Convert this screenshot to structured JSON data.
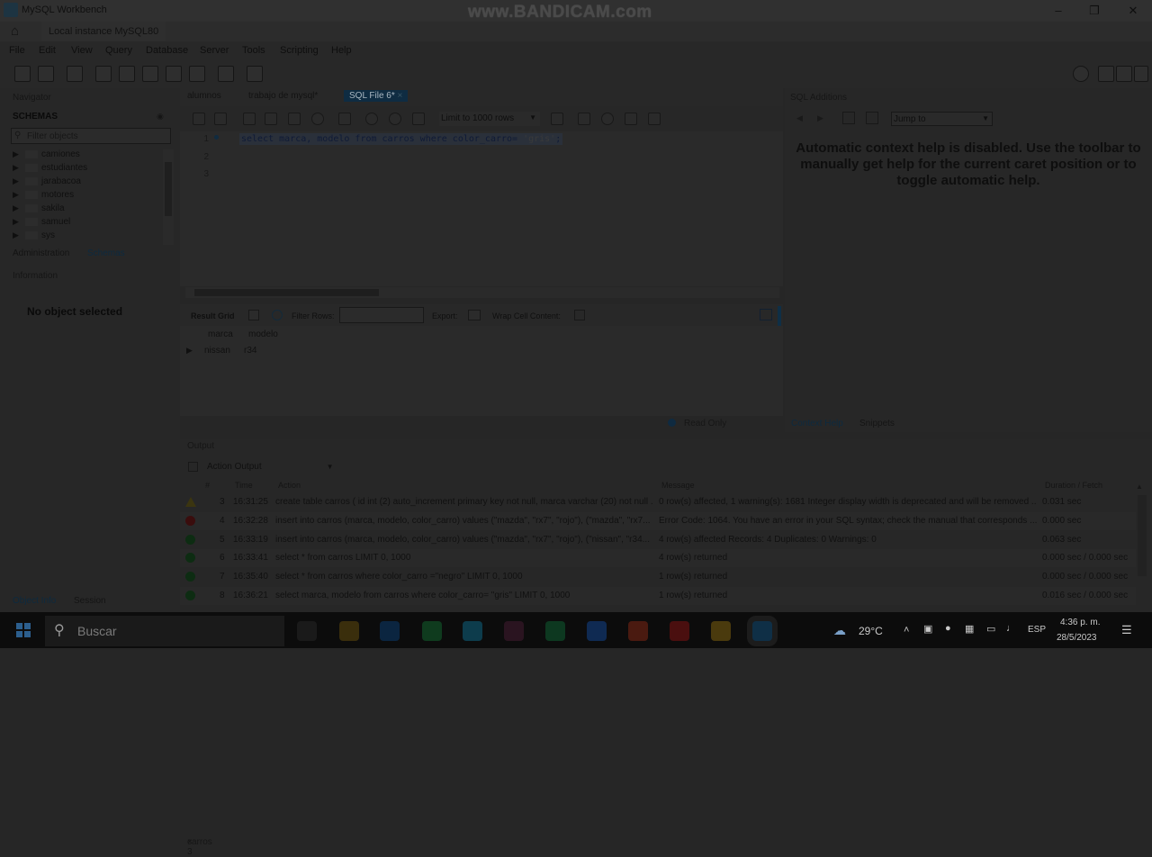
{
  "window": {
    "title": "MySQL Workbench",
    "watermark": "www.BANDICAM.com",
    "minimize_icon": "minimize-icon",
    "maximize_icon": "maximize-icon",
    "close_icon": "close-icon"
  },
  "connection_tab": {
    "label": "Local instance MySQL80"
  },
  "menu": [
    "File",
    "Edit",
    "View",
    "Query",
    "Database",
    "Server",
    "Tools",
    "Scripting",
    "Help"
  ],
  "navigator": {
    "header": "Navigator",
    "schemas_title": "SCHEMAS",
    "filter_placeholder": "Filter objects",
    "schemas": [
      "camiones",
      "estudiantes",
      "jarabacoa",
      "motores",
      "sakila",
      "samuel",
      "sys"
    ],
    "tabs": {
      "administration": "Administration",
      "schemas": "Schemas"
    },
    "information_header": "Information",
    "no_object": "No object selected",
    "bottom_tabs": {
      "object_info": "Object Info",
      "session": "Session"
    }
  },
  "query_tabs": [
    {
      "label": "alumnos"
    },
    {
      "label": "trabajo de mysql*"
    },
    {
      "label": "SQL File 6*",
      "active": true
    }
  ],
  "query_toolbar": {
    "limit": "Limit to 1000 rows"
  },
  "editor": {
    "line_numbers": [
      "1",
      "2",
      "3"
    ],
    "sql_pre": "select marca, modelo from carros where color_carro= ",
    "sql_str": "'gris'",
    "sql_post": ";"
  },
  "result_toolbar": {
    "result_grid": "Result Grid",
    "filter_rows": "Filter Rows:",
    "export": "Export:",
    "wrap": "Wrap Cell Content:"
  },
  "result_grid": {
    "columns": [
      "marca",
      "modelo"
    ],
    "rows": [
      [
        "nissan",
        "r34"
      ]
    ]
  },
  "result_tabs": {
    "tab": "carros 3",
    "read_only": "Read Only"
  },
  "sql_additions": {
    "header": "SQL Additions",
    "jump_to": "Jump to",
    "help_text": "Automatic context help is disabled. Use the toolbar to manually get help for the current caret position or to toggle automatic help.",
    "tabs": {
      "context_help": "Context Help",
      "snippets": "Snippets"
    }
  },
  "output": {
    "header": "Output",
    "selector": "Action Output",
    "columns": {
      "num": "#",
      "time": "Time",
      "action": "Action",
      "message": "Message",
      "duration": "Duration / Fetch"
    },
    "rows": [
      {
        "status": "warn",
        "num": "3",
        "time": "16:31:25",
        "action": "create table carros ( id int (2) auto_increment primary key not null, marca varchar (20) not null ...",
        "message": "0 row(s) affected, 1 warning(s): 1681 Integer display width is deprecated and will be removed ...",
        "duration": "0.031 sec"
      },
      {
        "status": "err",
        "num": "4",
        "time": "16:32:28",
        "action": "insert into carros (marca, modelo, color_carro) values (\"mazda\", \"rx7\", \"rojo\"), (\"mazda\", \"rx7...",
        "message": "Error Code: 1064. You have an error in your SQL syntax; check the manual that corresponds ...",
        "duration": "0.000 sec"
      },
      {
        "status": "ok",
        "num": "5",
        "time": "16:33:19",
        "action": "insert into carros (marca, modelo, color_carro) values (\"mazda\", \"rx7\", \"rojo\"), (\"nissan\", \"r34...",
        "message": "4 row(s) affected Records: 4  Duplicates: 0  Warnings: 0",
        "duration": "0.063 sec"
      },
      {
        "status": "ok",
        "num": "6",
        "time": "16:33:41",
        "action": "select * from carros LIMIT 0, 1000",
        "message": "4 row(s) returned",
        "duration": "0.000 sec / 0.000 sec"
      },
      {
        "status": "ok",
        "num": "7",
        "time": "16:35:40",
        "action": "select * from carros where color_carro =\"negro\" LIMIT 0, 1000",
        "message": "1 row(s) returned",
        "duration": "0.000 sec / 0.000 sec"
      },
      {
        "status": "ok",
        "num": "8",
        "time": "16:36:21",
        "action": "select marca, modelo from carros where color_carro= \"gris\" LIMIT 0, 1000",
        "message": "1 row(s) returned",
        "duration": "0.016 sec / 0.000 sec"
      }
    ]
  },
  "taskbar": {
    "search": "Buscar",
    "weather": "29°C",
    "lang": "ESP",
    "time": "4:36 p. m.",
    "date": "28/5/2023",
    "apps": [
      "task-view-icon",
      "file-explorer-icon",
      "photoshop-icon",
      "whatsapp-icon",
      "edge-icon",
      "store-icon",
      "excel-icon",
      "word-icon",
      "powerpoint-icon",
      "acrobat-icon",
      "chrome-icon",
      "mysql-workbench-icon"
    ],
    "colors": {
      "photoshop": "#0b2540",
      "whatsapp": "#0f3b1e",
      "edge": "#0d3c4c",
      "excel": "#0d3820",
      "word": "#0f2a52",
      "powerpoint": "#4a1a10",
      "acrobat": "#4a0f0f",
      "chrome": "#4a3a0d"
    }
  }
}
